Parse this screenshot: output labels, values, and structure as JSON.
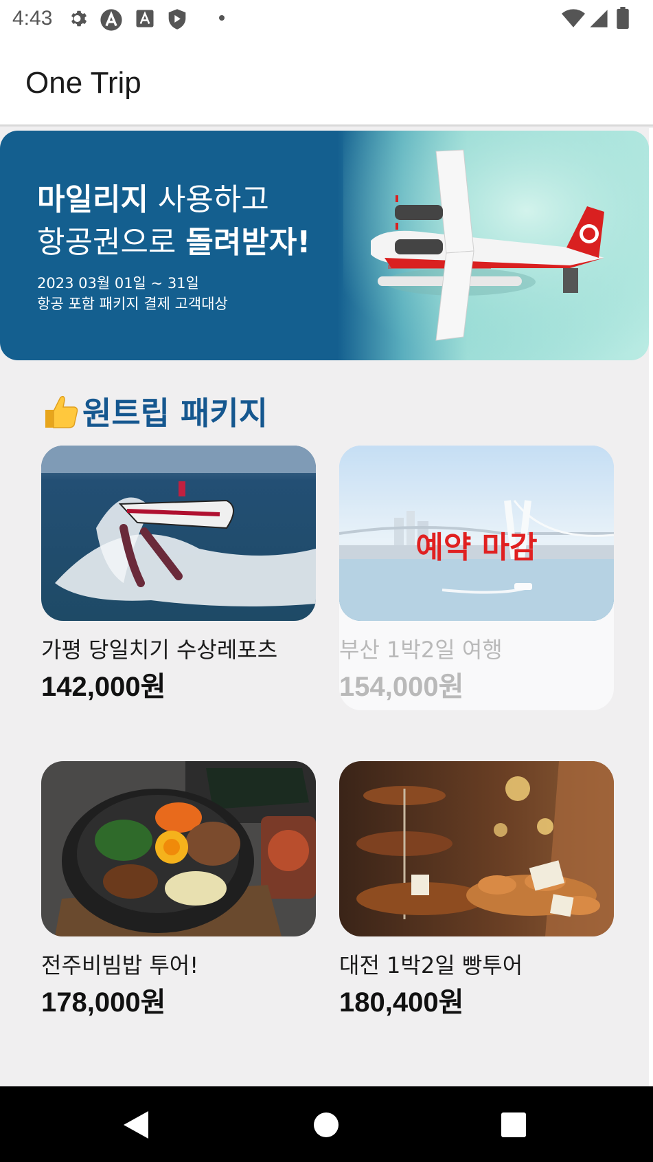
{
  "status_bar": {
    "time": "4:43",
    "left_icons": [
      "settings-icon",
      "android-studio-icon",
      "font-a-icon",
      "play-shield-icon",
      "dot-icon"
    ],
    "right_icons": [
      "wifi-icon",
      "signal-icon",
      "battery-icon"
    ]
  },
  "app_bar": {
    "title": "One Trip"
  },
  "banner": {
    "line1_bold": "마일리지",
    "line1_rest": " 사용하고",
    "line2_rest": "항공권으로 ",
    "line2_bold": "돌려받자!",
    "date": "2023 03월 01일 ~ 31일",
    "description": "항공 포함 패키지 결제 고객대상"
  },
  "section": {
    "title": "원트립 패키지",
    "icon": "thumbs-up-icon"
  },
  "packages": [
    {
      "name": "가평 당일치기 수상레포츠",
      "price": "142,000원",
      "closed": false,
      "image": "jet-ski-photo"
    },
    {
      "name": "부산 1박2일 여행",
      "price": "154,000원",
      "closed": true,
      "closed_label": "예약 마감",
      "image": "busan-bridge-photo"
    },
    {
      "name": "전주비빔밥 투어!",
      "price": "178,000원",
      "closed": false,
      "image": "bibimbap-photo"
    },
    {
      "name": "대전 1박2일 빵투어",
      "price": "180,400원",
      "closed": false,
      "image": "bakery-photo"
    }
  ],
  "nav_bar": {
    "buttons": [
      "back-icon",
      "home-icon",
      "recents-icon"
    ]
  },
  "colors": {
    "accent": "#15578f",
    "banner": "#145f8f",
    "closed_label": "#e02020",
    "background": "#f0eff0"
  }
}
